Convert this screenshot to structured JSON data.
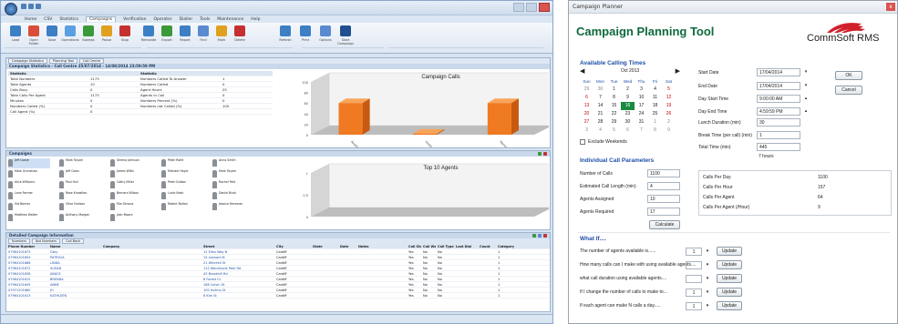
{
  "left_app": {
    "menu_tabs": [
      "Home",
      "CSV",
      "Statistics",
      "Campaigns",
      "Verification",
      "Operator",
      "Dialler",
      "Tools",
      "Maintenance",
      "Help"
    ],
    "active_tab": "Campaigns",
    "ribbon_buttons": [
      "Load",
      "Open Folder",
      "Save",
      "Operations",
      "Sweeps",
      "Pause",
      "Stop",
      "Reinstate",
      "Export",
      "Report",
      "Find",
      "Mark",
      "Delete",
      "Refresh",
      "Print",
      "Options",
      "Start Campaign"
    ],
    "stats_tabs": [
      "Campaign Statistics",
      "Planning Tool",
      "Call Centre"
    ],
    "stats_title": "Campaign Statistics - Call Centre 25/07/2014 - 14/08/2014 23:59:59 PM",
    "stats_headers": [
      "Statistic",
      "",
      "Statistic",
      ""
    ],
    "stats_rows": [
      [
        "Total Numbers",
        "1173",
        "Numbers Called To Answer",
        "1"
      ],
      [
        "Total Agents",
        "10",
        "Numbers Called",
        "0"
      ],
      [
        "Calls Busy",
        "0",
        "Agent Hours",
        "25"
      ],
      [
        "Total Calls Per Agent",
        "1173",
        "Agents In Call",
        "0"
      ],
      [
        "Minutes",
        "0",
        "Numbers Percent (%)",
        "0"
      ],
      [
        "Numbers Called (%)",
        "0",
        "Numbers not Called (%)",
        "100"
      ],
      [
        "Call Agent (%)",
        "0",
        "",
        ""
      ]
    ],
    "chart_campaign": {
      "type": "bar",
      "title": "Campaign Calls",
      "categories": [
        "Available",
        "Used",
        "Remaining"
      ],
      "values": [
        60,
        2,
        60
      ],
      "ylim": [
        0,
        100
      ],
      "y_ticks": [
        "100",
        "80",
        "60",
        "40",
        "20",
        "0"
      ]
    },
    "agents_title": "Campaigns",
    "agents": [
      [
        "Jeff Cowie",
        "Mark Toyam",
        "Serena Johnson",
        "Peter Rolfe",
        "Anna Smith"
      ],
      [
        "Mark Grimshaw",
        "Jeff Cown",
        "James Willis",
        "Michael Hoyle",
        "Mark Toyam"
      ],
      [
        "Alice Williams",
        "Paul Hull",
        "Cathy Miller",
        "Peter Dutton",
        "Rachel Pott"
      ],
      [
        "Lane Farmer",
        "Rose Knowlton",
        "Bernard Wilson",
        "Lucie Nash",
        "Daniel Bush"
      ],
      [
        "Sid Barnes",
        "Olive Hudson",
        "Mia Simons",
        "Robert Bolton",
        "Jessica Hersman"
      ],
      [
        "Matthew Walter",
        "Anthony Morgan",
        "Josh Moore",
        "",
        ""
      ]
    ],
    "chart_agents": {
      "type": "bar",
      "title": "Top 10 Agents",
      "categories": [],
      "values": [],
      "ylim": [
        0,
        1
      ],
      "y_ticks": [
        "1",
        "0.5",
        "0"
      ]
    },
    "detail_title": "Detailed Campaign Information",
    "detail_tabs": [
      "Numbers",
      "Not Numbers",
      "Call Back"
    ],
    "detail_headers": [
      "Phone Number",
      "Name",
      "Company",
      "",
      "Street",
      "City",
      "State",
      "Date",
      "Notes",
      "Call Stat",
      "Call Wait",
      "Call Type",
      "Last Dial",
      "Count",
      "Category"
    ],
    "detail_rows": [
      [
        "07964101673",
        "Gary",
        "",
        "",
        "12 Elms Way N",
        "Cardiff",
        "",
        "",
        "",
        "Yes",
        "No",
        "No",
        "",
        "",
        "1"
      ],
      [
        "07964101654",
        "PATRICIA",
        "",
        "",
        "15 Leonard N",
        "Cardiff",
        "",
        "",
        "",
        "Yes",
        "No",
        "No",
        "",
        "",
        "1"
      ],
      [
        "07964101686",
        "LINDA",
        "",
        "",
        "21 Whinfell St",
        "Cardiff",
        "",
        "",
        "",
        "Yes",
        "No",
        "No",
        "",
        "",
        "1"
      ],
      [
        "07964101672",
        "SUSAN",
        "",
        "",
        "112 Wendhurst Park Rd",
        "Cardiff",
        "",
        "",
        "",
        "Yes",
        "No",
        "No",
        "",
        "",
        "1"
      ],
      [
        "07964101638",
        "JANICE",
        "",
        "",
        "43 Brookhill Rd",
        "Cardiff",
        "",
        "",
        "",
        "Yes",
        "No",
        "No",
        "",
        "",
        "1"
      ],
      [
        "07964101612",
        "BRENDA",
        "",
        "",
        "8 Forest Ct",
        "Cardiff",
        "",
        "",
        "",
        "Yes",
        "No",
        "No",
        "",
        "",
        "1"
      ],
      [
        "07964101645",
        "ANNE",
        "",
        "",
        "188 Colvin St",
        "Cardiff",
        "",
        "",
        "",
        "Yes",
        "No",
        "No",
        "",
        "",
        "1"
      ],
      [
        "07971201680",
        "JO",
        "",
        "",
        "100 Hollins St",
        "Cardiff",
        "",
        "",
        "",
        "Yes",
        "No",
        "No",
        "",
        "",
        "1"
      ],
      [
        "07964101613",
        "KATHLEEN",
        "",
        "",
        "6 Kirk St",
        "Cardiff",
        "",
        "",
        "",
        "Yes",
        "No",
        "No",
        "",
        "",
        "1"
      ]
    ]
  },
  "planner": {
    "window_title": "Campaign Planner",
    "close_glyph": "x",
    "tool_title": "Campaign Planning Tool",
    "logo_text": "CommSoft RMS",
    "available_calling_times": "Available Calling Times",
    "calendar": {
      "month_label": "Oct 2013",
      "prev_glyph": "◀",
      "next_glyph": "▶",
      "dow": [
        "Sun",
        "Mon",
        "Tue",
        "Wed",
        "Thu",
        "Fri",
        "Sat"
      ],
      "weeks": [
        [
          "29",
          "30",
          "1",
          "2",
          "3",
          "4",
          "5"
        ],
        [
          "6",
          "7",
          "8",
          "9",
          "10",
          "11",
          "12"
        ],
        [
          "13",
          "14",
          "15",
          "16",
          "17",
          "18",
          "19"
        ],
        [
          "20",
          "21",
          "22",
          "23",
          "24",
          "25",
          "26"
        ],
        [
          "27",
          "28",
          "29",
          "30",
          "31",
          "1",
          "2"
        ],
        [
          "3",
          "4",
          "5",
          "6",
          "7",
          "8",
          "9"
        ]
      ],
      "today": "16"
    },
    "exclude_weekends": "Exclude Weekends",
    "start_date_label": "Start Date",
    "start_date": "17/04/2014",
    "end_date_label": "End Date",
    "end_date": "17/04/2014",
    "day_start_label": "Day Start Time",
    "day_start": "9:00:00 AM",
    "day_end_label": "Day End Time",
    "day_end": "4:59:59 PM",
    "lunch_label": "Lunch Duration (min)",
    "lunch": "30",
    "break_label": "Break Time (per call) (min)",
    "break": "1",
    "total_time_label": "Total Time (min)",
    "total_time": "445",
    "hours_text": "7 hours",
    "ok": "OK",
    "cancel": "Cancel",
    "individual_params": "Individual Call Parameters",
    "num_calls_label": "Number of Calls",
    "num_calls": "1100",
    "est_len_label": "Estimated Call Length (min)",
    "est_len": "4",
    "agents_assigned_label": "Agents Assigned",
    "agents_assigned": "10",
    "agents_required_label": "Agents Required",
    "agents_required": "17",
    "calculate": "Calculate",
    "results": [
      {
        "label": "Calls Per Day",
        "value": "1100"
      },
      {
        "label": "Calls Per Hour",
        "value": "157"
      },
      {
        "label": "Calls Per Agent",
        "value": "64"
      },
      {
        "label": "Calls Per Agent (/Hour)",
        "value": "9"
      }
    ],
    "what_if": "What If....",
    "what_if_rows": [
      {
        "q": "The number of agents available is......",
        "v": "1"
      },
      {
        "q": "How many calls can I make with using available agents....",
        "v": ""
      },
      {
        "q": "what call duration using available agents....",
        "v": ""
      },
      {
        "q": "If I change the number of calls to make to...",
        "v": "1"
      },
      {
        "q": "If each agent can make N calls a day.....",
        "v": "1"
      }
    ],
    "update": "Update",
    "colors": {
      "green_title": "#0e6a3b",
      "blue_label": "#1f4fa8",
      "logo_red": "#d0202a",
      "bar_orange": "#f07a22"
    }
  }
}
